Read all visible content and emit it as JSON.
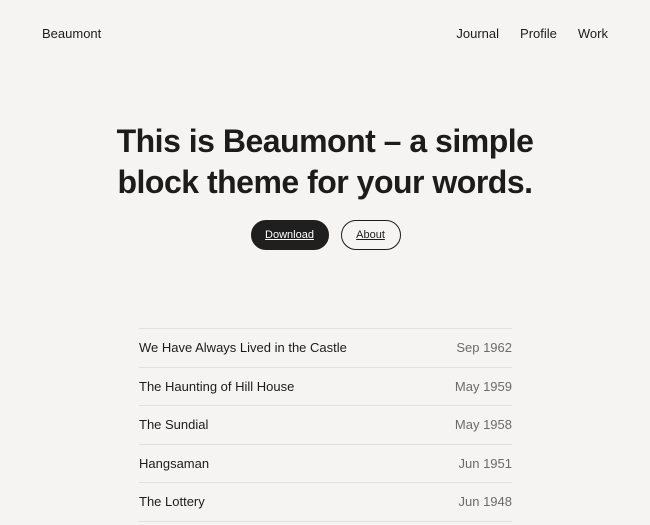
{
  "header": {
    "site_title": "Beaumont",
    "nav": [
      {
        "label": "Journal"
      },
      {
        "label": "Profile"
      },
      {
        "label": "Work"
      }
    ]
  },
  "hero": {
    "heading_line1": "This is Beaumont – a simple",
    "heading_line2": "block theme for your words.",
    "primary_button": "Download",
    "secondary_button": "About"
  },
  "posts": [
    {
      "title": "We Have Always Lived in the Castle",
      "date": "Sep 1962"
    },
    {
      "title": "The Haunting of Hill House",
      "date": "May 1959"
    },
    {
      "title": "The Sundial",
      "date": "May 1958"
    },
    {
      "title": "Hangsaman",
      "date": "Jun 1951"
    },
    {
      "title": "The Lottery",
      "date": "Jun 1948"
    }
  ],
  "colors": {
    "background": "#f5f4f2",
    "text": "#1c1c1c",
    "button_dark": "#1e1f1e",
    "muted": "#6b6b6b",
    "divider": "#e2e0dc"
  }
}
